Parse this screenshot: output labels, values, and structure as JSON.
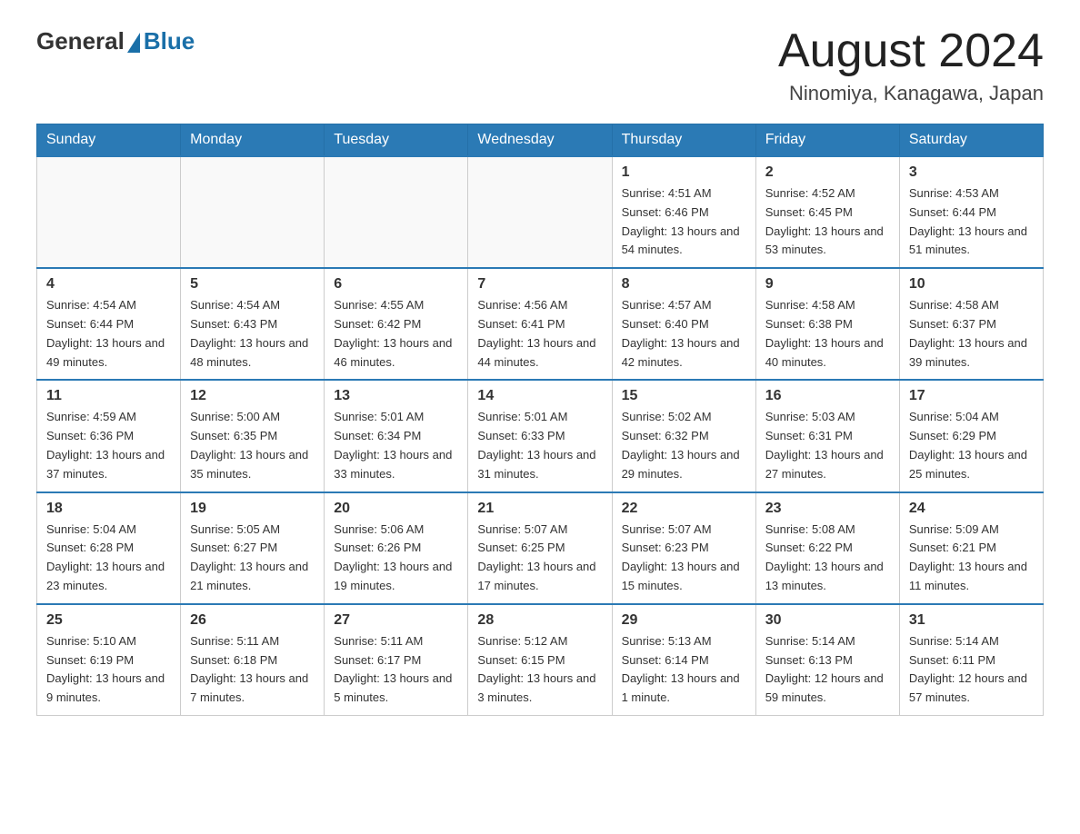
{
  "logo": {
    "general": "General",
    "blue": "Blue",
    "subtitle": ""
  },
  "header": {
    "month_year": "August 2024",
    "location": "Ninomiya, Kanagawa, Japan"
  },
  "weekdays": [
    "Sunday",
    "Monday",
    "Tuesday",
    "Wednesday",
    "Thursday",
    "Friday",
    "Saturday"
  ],
  "weeks": [
    [
      {
        "day": "",
        "info": ""
      },
      {
        "day": "",
        "info": ""
      },
      {
        "day": "",
        "info": ""
      },
      {
        "day": "",
        "info": ""
      },
      {
        "day": "1",
        "info": "Sunrise: 4:51 AM\nSunset: 6:46 PM\nDaylight: 13 hours and 54 minutes."
      },
      {
        "day": "2",
        "info": "Sunrise: 4:52 AM\nSunset: 6:45 PM\nDaylight: 13 hours and 53 minutes."
      },
      {
        "day": "3",
        "info": "Sunrise: 4:53 AM\nSunset: 6:44 PM\nDaylight: 13 hours and 51 minutes."
      }
    ],
    [
      {
        "day": "4",
        "info": "Sunrise: 4:54 AM\nSunset: 6:44 PM\nDaylight: 13 hours and 49 minutes."
      },
      {
        "day": "5",
        "info": "Sunrise: 4:54 AM\nSunset: 6:43 PM\nDaylight: 13 hours and 48 minutes."
      },
      {
        "day": "6",
        "info": "Sunrise: 4:55 AM\nSunset: 6:42 PM\nDaylight: 13 hours and 46 minutes."
      },
      {
        "day": "7",
        "info": "Sunrise: 4:56 AM\nSunset: 6:41 PM\nDaylight: 13 hours and 44 minutes."
      },
      {
        "day": "8",
        "info": "Sunrise: 4:57 AM\nSunset: 6:40 PM\nDaylight: 13 hours and 42 minutes."
      },
      {
        "day": "9",
        "info": "Sunrise: 4:58 AM\nSunset: 6:38 PM\nDaylight: 13 hours and 40 minutes."
      },
      {
        "day": "10",
        "info": "Sunrise: 4:58 AM\nSunset: 6:37 PM\nDaylight: 13 hours and 39 minutes."
      }
    ],
    [
      {
        "day": "11",
        "info": "Sunrise: 4:59 AM\nSunset: 6:36 PM\nDaylight: 13 hours and 37 minutes."
      },
      {
        "day": "12",
        "info": "Sunrise: 5:00 AM\nSunset: 6:35 PM\nDaylight: 13 hours and 35 minutes."
      },
      {
        "day": "13",
        "info": "Sunrise: 5:01 AM\nSunset: 6:34 PM\nDaylight: 13 hours and 33 minutes."
      },
      {
        "day": "14",
        "info": "Sunrise: 5:01 AM\nSunset: 6:33 PM\nDaylight: 13 hours and 31 minutes."
      },
      {
        "day": "15",
        "info": "Sunrise: 5:02 AM\nSunset: 6:32 PM\nDaylight: 13 hours and 29 minutes."
      },
      {
        "day": "16",
        "info": "Sunrise: 5:03 AM\nSunset: 6:31 PM\nDaylight: 13 hours and 27 minutes."
      },
      {
        "day": "17",
        "info": "Sunrise: 5:04 AM\nSunset: 6:29 PM\nDaylight: 13 hours and 25 minutes."
      }
    ],
    [
      {
        "day": "18",
        "info": "Sunrise: 5:04 AM\nSunset: 6:28 PM\nDaylight: 13 hours and 23 minutes."
      },
      {
        "day": "19",
        "info": "Sunrise: 5:05 AM\nSunset: 6:27 PM\nDaylight: 13 hours and 21 minutes."
      },
      {
        "day": "20",
        "info": "Sunrise: 5:06 AM\nSunset: 6:26 PM\nDaylight: 13 hours and 19 minutes."
      },
      {
        "day": "21",
        "info": "Sunrise: 5:07 AM\nSunset: 6:25 PM\nDaylight: 13 hours and 17 minutes."
      },
      {
        "day": "22",
        "info": "Sunrise: 5:07 AM\nSunset: 6:23 PM\nDaylight: 13 hours and 15 minutes."
      },
      {
        "day": "23",
        "info": "Sunrise: 5:08 AM\nSunset: 6:22 PM\nDaylight: 13 hours and 13 minutes."
      },
      {
        "day": "24",
        "info": "Sunrise: 5:09 AM\nSunset: 6:21 PM\nDaylight: 13 hours and 11 minutes."
      }
    ],
    [
      {
        "day": "25",
        "info": "Sunrise: 5:10 AM\nSunset: 6:19 PM\nDaylight: 13 hours and 9 minutes."
      },
      {
        "day": "26",
        "info": "Sunrise: 5:11 AM\nSunset: 6:18 PM\nDaylight: 13 hours and 7 minutes."
      },
      {
        "day": "27",
        "info": "Sunrise: 5:11 AM\nSunset: 6:17 PM\nDaylight: 13 hours and 5 minutes."
      },
      {
        "day": "28",
        "info": "Sunrise: 5:12 AM\nSunset: 6:15 PM\nDaylight: 13 hours and 3 minutes."
      },
      {
        "day": "29",
        "info": "Sunrise: 5:13 AM\nSunset: 6:14 PM\nDaylight: 13 hours and 1 minute."
      },
      {
        "day": "30",
        "info": "Sunrise: 5:14 AM\nSunset: 6:13 PM\nDaylight: 12 hours and 59 minutes."
      },
      {
        "day": "31",
        "info": "Sunrise: 5:14 AM\nSunset: 6:11 PM\nDaylight: 12 hours and 57 minutes."
      }
    ]
  ]
}
